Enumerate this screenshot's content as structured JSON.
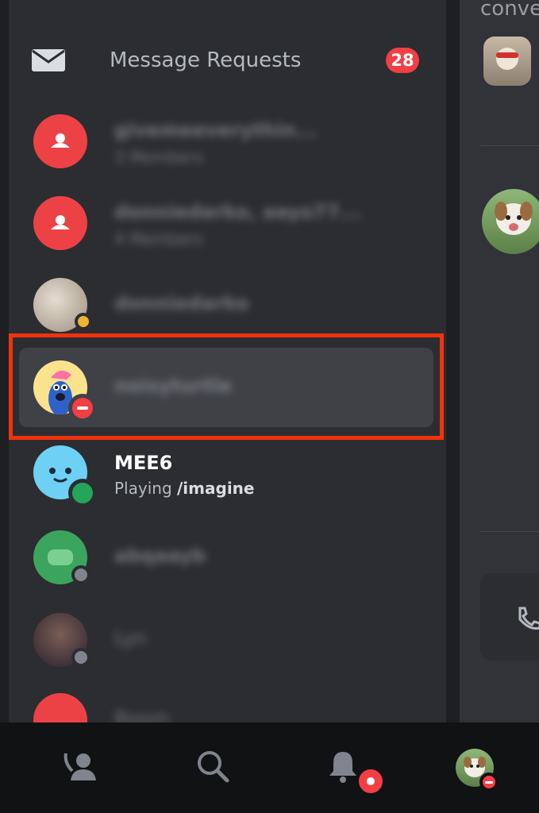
{
  "message_requests": {
    "label": "Message Requests",
    "count": "28"
  },
  "dm_list": [
    {
      "name": "givemeeverythin...",
      "sub": "3 Members",
      "blurred": true
    },
    {
      "name": "donniedarko, aayo77...",
      "sub": "4 Members",
      "blurred": true
    },
    {
      "name": "donniedarko",
      "sub": "",
      "blurred": true
    },
    {
      "name": "noisyturtle",
      "sub": "",
      "blurred": true
    },
    {
      "name": "MEE6",
      "sub_prefix": "Playing ",
      "sub_bold": "/imagine",
      "blurred": false
    },
    {
      "name": "abqaayb",
      "sub": "",
      "blurred": true
    },
    {
      "name": "Lyn",
      "sub": "",
      "blurred": true
    },
    {
      "name": "Boom",
      "sub": "",
      "blurred": true
    }
  ],
  "right_panel": {
    "header_text": "conve"
  },
  "colors": {
    "accent_red": "#f23f43",
    "highlight_border": "#f0330c",
    "online_green": "#23a55a",
    "panel_bg": "#2b2d31"
  },
  "bottom_nav": [
    "friends-icon",
    "search-icon",
    "notifications-icon",
    "profile-avatar"
  ]
}
